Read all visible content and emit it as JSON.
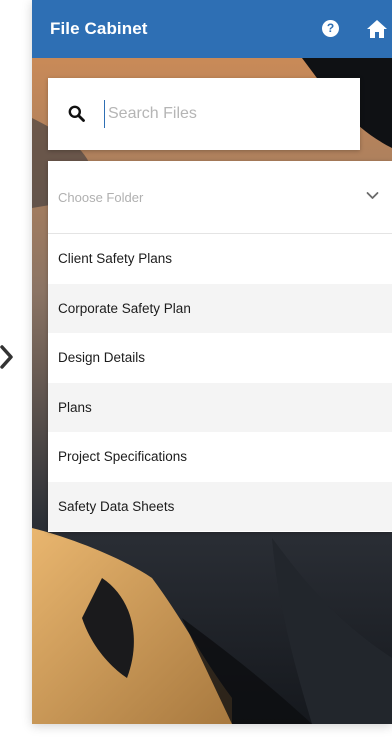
{
  "header": {
    "title": "File Cabinet",
    "help_icon": "help-icon",
    "help_glyph": "?",
    "home_icon": "home-icon"
  },
  "search": {
    "icon": "search-icon",
    "placeholder": "Search Files",
    "value": ""
  },
  "folder_select": {
    "placeholder": "Choose Folder",
    "icon": "chevron-down-icon"
  },
  "folders": [
    {
      "label": "Client Safety Plans"
    },
    {
      "label": "Corporate Safety Plan"
    },
    {
      "label": "Design Details"
    },
    {
      "label": "Plans"
    },
    {
      "label": "Project Specifications"
    },
    {
      "label": "Safety Data Sheets"
    }
  ],
  "colors": {
    "header": "#2e6fb4",
    "row_alt": "#f4f4f4",
    "placeholder": "#b0b0b0"
  }
}
